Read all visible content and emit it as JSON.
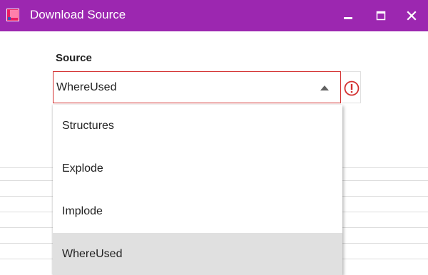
{
  "window": {
    "title": "Download Source",
    "controls": {
      "minimize_icon": "minimize-icon",
      "maximize_icon": "maximize-icon",
      "close_icon": "close-icon"
    },
    "titlebar_color": "#9c27b0"
  },
  "form": {
    "source_label": "Source",
    "source_value": "WhereUsed",
    "error_color": "#d32f2f",
    "error_icon": "exclamation-circle-icon"
  },
  "dropdown": {
    "options": [
      {
        "label": "Structures",
        "selected": false
      },
      {
        "label": "Explode",
        "selected": false
      },
      {
        "label": "Implode",
        "selected": false
      },
      {
        "label": "WhereUsed",
        "selected": true
      }
    ]
  }
}
